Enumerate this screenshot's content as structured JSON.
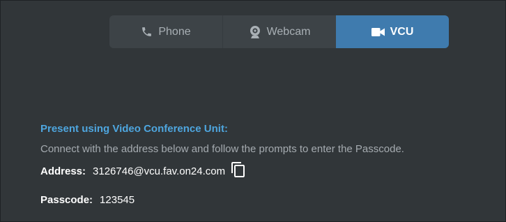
{
  "tabs": [
    {
      "label": "Phone",
      "icon": "phone-icon",
      "active": false
    },
    {
      "label": "Webcam",
      "icon": "webcam-icon",
      "active": false
    },
    {
      "label": "VCU",
      "icon": "video-camera-icon",
      "active": true
    }
  ],
  "vcu": {
    "heading": "Present using Video Conference Unit:",
    "description": "Connect with the address below and follow the prompts to enter the Passcode.",
    "address_label": "Address:",
    "address_value": "3126746@vcu.fav.on24.com",
    "passcode_label": "Passcode:",
    "passcode_value": "123545",
    "copy_icon": "copy-icon"
  },
  "colors": {
    "background": "#313639",
    "tab_bg": "#3d4347",
    "active_tab": "#3f7bae",
    "heading": "#4ea6df",
    "muted_text": "#a5abb0",
    "text": "#ffffff"
  }
}
